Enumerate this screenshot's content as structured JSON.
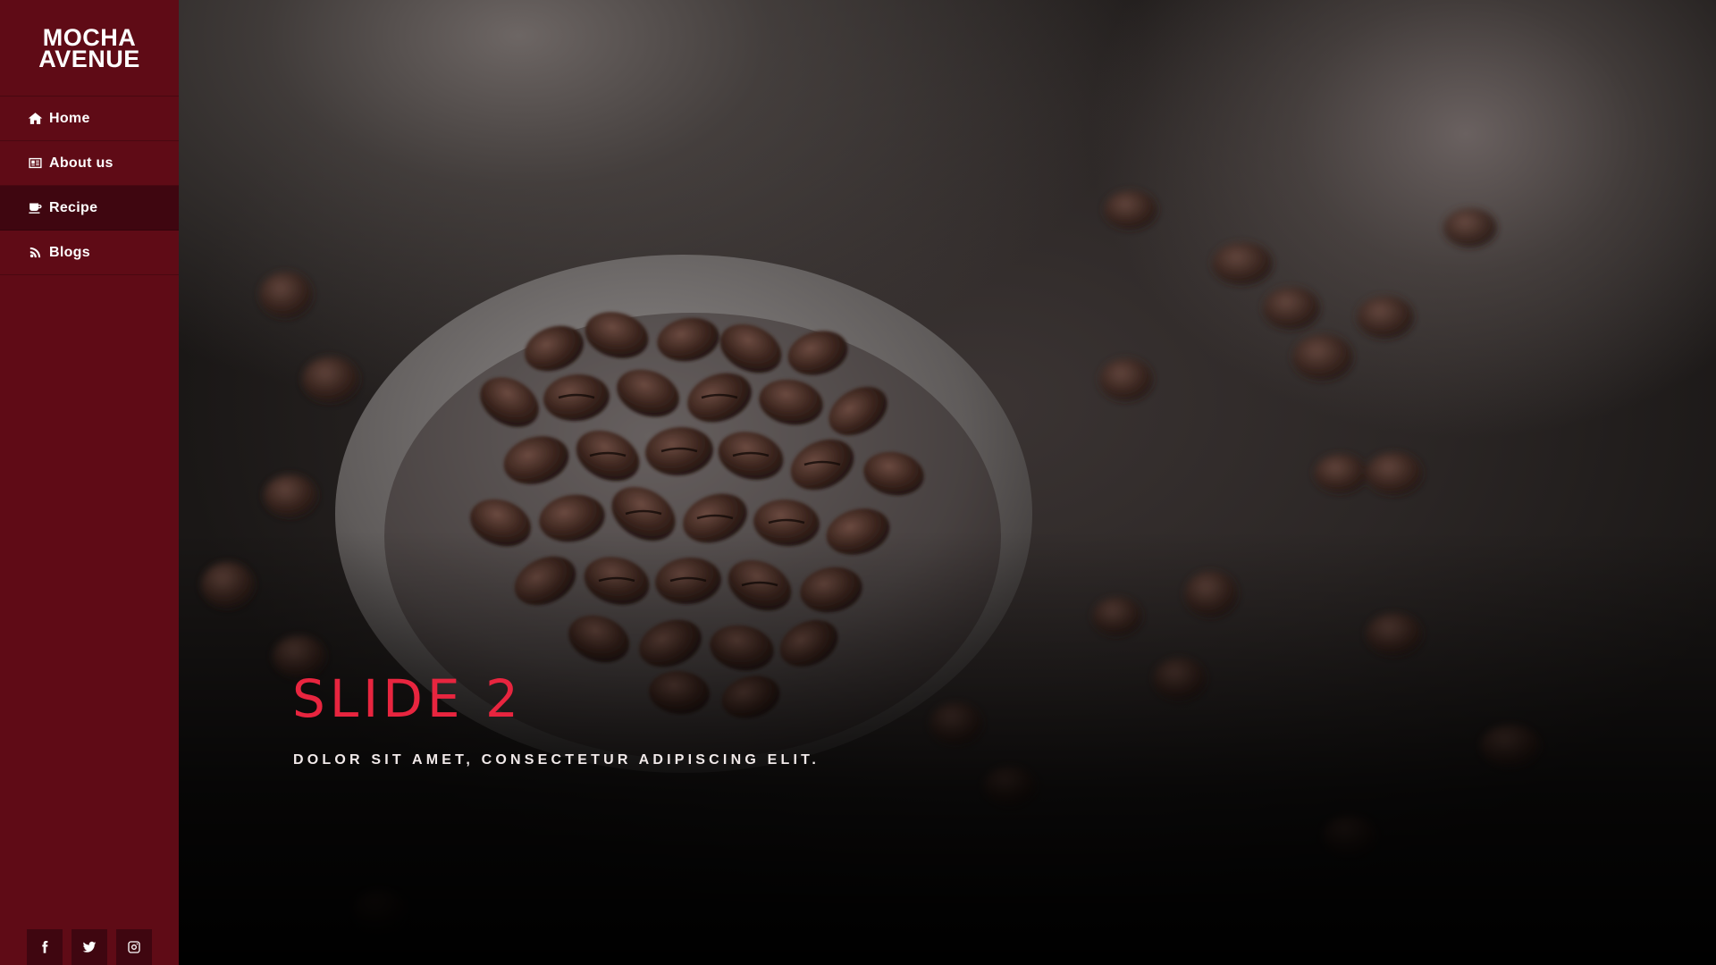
{
  "brand": {
    "line1": "MOCHA",
    "line2": "AVENUE"
  },
  "nav": {
    "items": [
      {
        "label": "Home",
        "icon": "home-icon",
        "active": false
      },
      {
        "label": "About us",
        "icon": "id-card-icon",
        "active": false
      },
      {
        "label": "Recipe",
        "icon": "coffee-cup-icon",
        "active": true
      },
      {
        "label": "Blogs",
        "icon": "rss-icon",
        "active": false
      }
    ]
  },
  "social": [
    {
      "name": "facebook",
      "icon": "facebook-icon"
    },
    {
      "name": "twitter",
      "icon": "twitter-icon"
    },
    {
      "name": "instagram",
      "icon": "instagram-icon"
    }
  ],
  "slide": {
    "title": "SLIDE 2",
    "subtitle": "DOLOR SIT AMET, CONSECTETUR ADIPISCING ELIT."
  },
  "colors": {
    "sidebar": "#5f0b16",
    "sidebar_active": "#3f0610",
    "accent": "#e8253f"
  }
}
